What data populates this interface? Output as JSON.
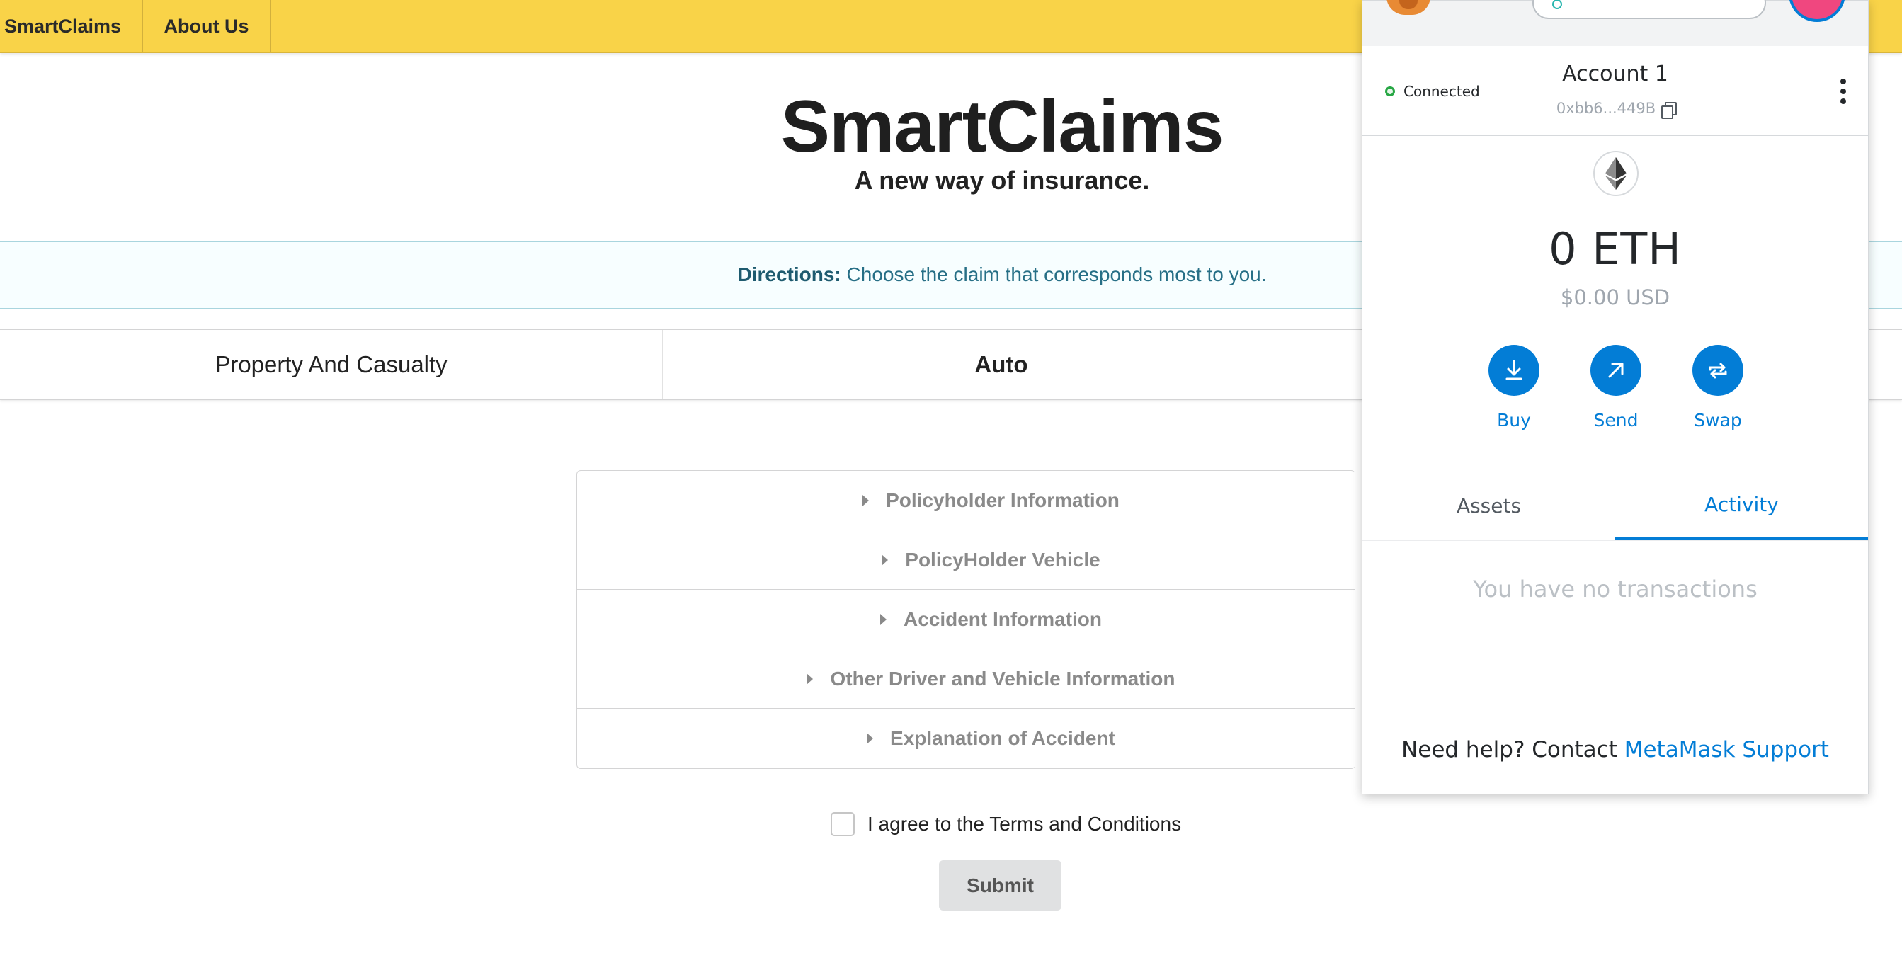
{
  "nav": {
    "brand": "SmartClaims",
    "about": "About Us"
  },
  "hero": {
    "title": "SmartClaims",
    "subtitle": "A new way of insurance."
  },
  "directions": {
    "label": "Directions:",
    "text": "Choose the claim that corresponds most to you."
  },
  "claim_tabs": [
    {
      "label": "Property And Casualty",
      "active": false
    },
    {
      "label": "Auto",
      "active": true
    }
  ],
  "accordion": [
    {
      "label": "Policyholder Information"
    },
    {
      "label": "PolicyHolder Vehicle"
    },
    {
      "label": "Accident Information"
    },
    {
      "label": "Other Driver and Vehicle Information"
    },
    {
      "label": "Explanation of Accident"
    }
  ],
  "agree": {
    "label": "I agree to the Terms and Conditions",
    "checked": false
  },
  "submit": {
    "label": "Submit"
  },
  "metamask": {
    "status": "Connected",
    "account_name": "Account 1",
    "address": "0xbb6...449B",
    "balance": "0 ETH",
    "fiat": "$0.00 USD",
    "actions": {
      "buy": "Buy",
      "send": "Send",
      "swap": "Swap"
    },
    "tabs": {
      "assets": "Assets",
      "activity": "Activity",
      "active": "activity"
    },
    "empty": "You have no transactions",
    "help_prefix": "Need help? Contact ",
    "help_link": "MetaMask Support",
    "colors": {
      "primary": "#037dd6",
      "connected": "#28a745",
      "avatar": "#f0477f"
    }
  },
  "colors": {
    "nav_background": "#f9d348",
    "directions_text": "#276f86"
  }
}
